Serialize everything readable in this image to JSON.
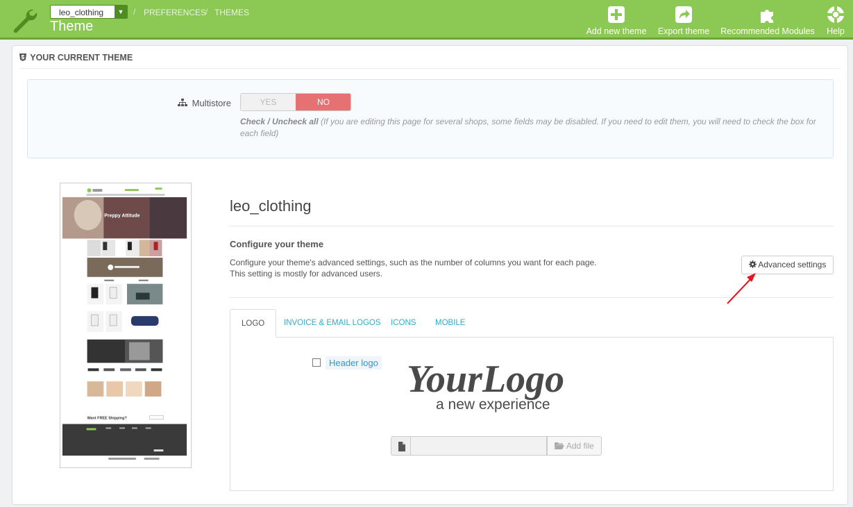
{
  "header": {
    "shop": "leo_clothing",
    "breadcrumbs": [
      "PREFERENCES",
      "THEMES"
    ],
    "title": "Theme",
    "actions": [
      {
        "label": "Add new theme",
        "icon": "plus-square-icon"
      },
      {
        "label": "Export theme",
        "icon": "share-icon"
      },
      {
        "label": "Recommended Modules",
        "icon": "puzzle-icon"
      },
      {
        "label": "Help",
        "icon": "lifebuoy-icon"
      }
    ]
  },
  "panel": {
    "heading": "YOUR CURRENT THEME",
    "multistore": {
      "label": "Multistore",
      "yes": "YES",
      "no": "NO",
      "selected": "NO",
      "help_bold": "Check / Uncheck all",
      "help_text": " (If you are editing this page for several shops, some fields may be disabled. If you need to edit them, you will need to check the box for each field)"
    },
    "theme_name": "leo_clothing",
    "configure": {
      "title": "Configure your theme",
      "desc_line1": "Configure your theme's advanced settings, such as the number of columns you want for each page.",
      "desc_line2": "This setting is mostly for advanced users.",
      "button": "Advanced settings"
    },
    "tabs": [
      "LOGO",
      "INVOICE & EMAIL LOGOS",
      "ICONS",
      "MOBILE"
    ],
    "active_tab": "LOGO",
    "logo": {
      "checkbox_label": "Header logo",
      "logo_text_main": "YourLogo",
      "logo_text_sub": "a new experience",
      "file_button": "Add file"
    }
  },
  "thumbnail": {
    "banner_text": "Preppy Attitude",
    "footer_text": "Want FREE Shipping?"
  },
  "colors": {
    "header_green": "#8bc954",
    "no_red": "#e57173",
    "link_blue": "#2eacce",
    "arrow_red": "#e8141b"
  }
}
